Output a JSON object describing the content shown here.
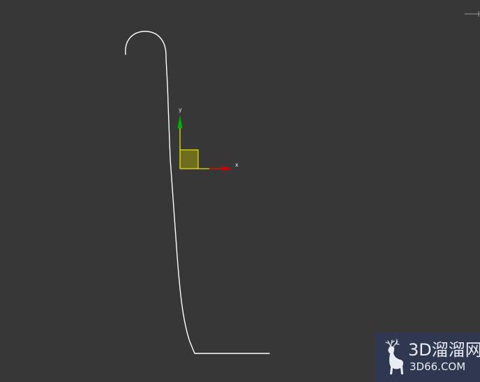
{
  "viewport": {
    "background_color": "#373737",
    "spline_color": "#ffffff"
  },
  "gizmo": {
    "x_axis_label": "x",
    "y_axis_label": "y",
    "x_axis_color": "#d00000",
    "y_axis_color": "#00b000",
    "plane_handle_color": "#e4e400"
  },
  "watermark": {
    "title": "3D溜溜网",
    "url": "3D66.COM",
    "background_color": "#2f3850",
    "logo_icon": "deer-icon"
  }
}
